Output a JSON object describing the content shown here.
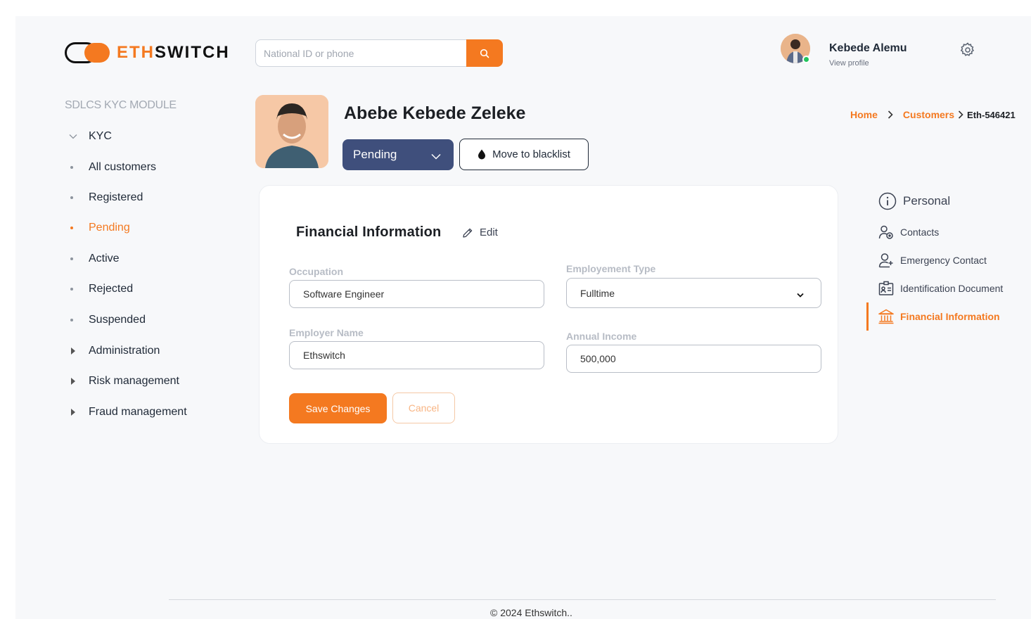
{
  "brand": {
    "part1": "ETH",
    "part2": "SWITCH",
    "accent": "#f47920"
  },
  "search": {
    "placeholder": "National ID or phone",
    "value": ""
  },
  "user": {
    "name": "Kebede Alemu",
    "sub": "View profile"
  },
  "sidebar": {
    "title": "SDLCS KYC MODULE",
    "items": [
      {
        "label": "KYC"
      },
      {
        "label": "All customers"
      },
      {
        "label": "Registered"
      },
      {
        "label": "Pending"
      },
      {
        "label": "Active"
      },
      {
        "label": "Rejected"
      },
      {
        "label": "Suspended"
      },
      {
        "label": "Administration"
      },
      {
        "label": "Risk management"
      },
      {
        "label": "Fraud management"
      }
    ]
  },
  "customer": {
    "name": "Abebe Kebede Zeleke",
    "status": "Pending",
    "blacklist_label": "Move to blacklist"
  },
  "breadcrumb": {
    "home": "Home",
    "customers": "Customers",
    "current": "Eth-546421"
  },
  "financial": {
    "title": "Financial Information",
    "edit_label": "Edit",
    "occupation": {
      "label": "Occupation",
      "value": "Software Engineer"
    },
    "employment_type": {
      "label": "Employement Type",
      "value": "Fulltime"
    },
    "employer_name": {
      "label": "Employer Name",
      "value": "Ethswitch"
    },
    "annual_income": {
      "label": "Annual Income",
      "value": "500,000"
    },
    "save_label": "Save Changes",
    "cancel_label": "Cancel"
  },
  "sections": [
    {
      "label": "Personal",
      "icon": "info-icon"
    },
    {
      "label": "Contacts",
      "icon": "contacts-icon"
    },
    {
      "label": "Emergency Contact",
      "icon": "user-plus-icon"
    },
    {
      "label": "Identification Document",
      "icon": "id-card-icon"
    },
    {
      "label": "Financial Information",
      "icon": "bank-icon"
    }
  ],
  "footer": {
    "text": "© 2024  Ethswitch.."
  }
}
